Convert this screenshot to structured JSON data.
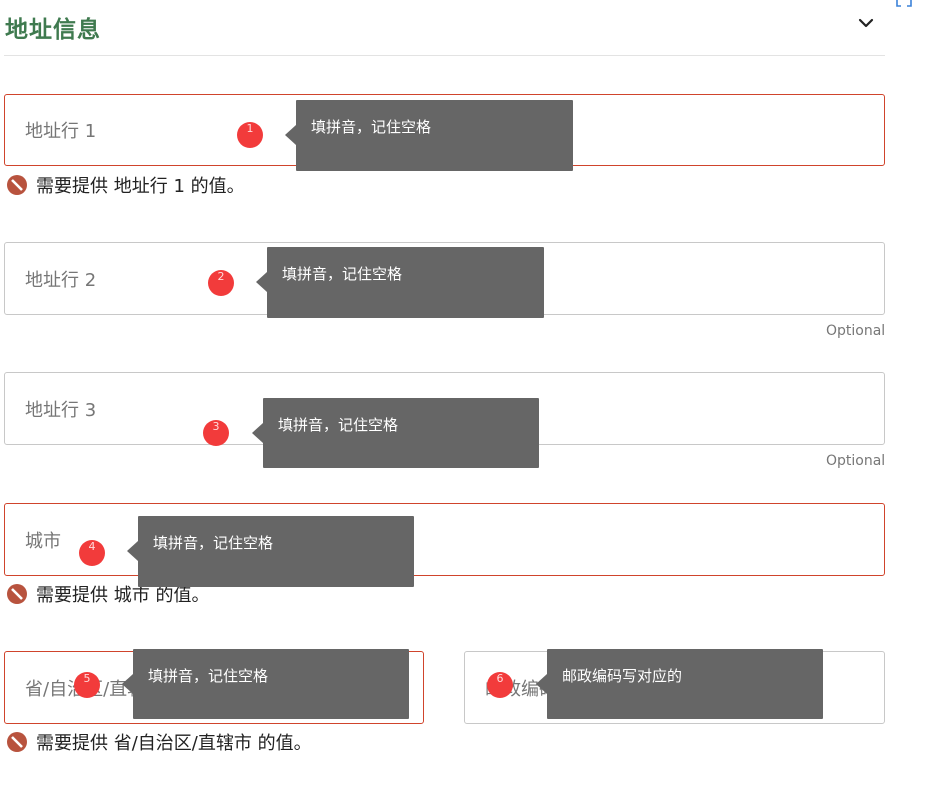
{
  "section": {
    "title": "地址信息"
  },
  "fields": {
    "address1": {
      "placeholder": "地址行 1",
      "error": "需要提供 地址行 1 的值。"
    },
    "address2": {
      "placeholder": "地址行 2",
      "optional": "Optional"
    },
    "address3": {
      "placeholder": "地址行 3",
      "optional": "Optional"
    },
    "city": {
      "placeholder": "城市",
      "error": "需要提供 城市 的值。"
    },
    "state": {
      "placeholder": "省/自治区/直辖市",
      "error": "需要提供 省/自治区/直辖市 的值。"
    },
    "postal": {
      "placeholder": "邮政编码"
    }
  },
  "tips": {
    "pinyin": "填拼音，记住空格",
    "postal": "邮政编码写对应的"
  },
  "markers": [
    "1",
    "2",
    "3",
    "4",
    "5",
    "6"
  ],
  "colors": {
    "title": "#3f7a4f",
    "error_border": "#d0442c",
    "error_icon": "#b8533e",
    "marker": "#f23b3b",
    "tooltip": "#666666"
  },
  "icons": {
    "collapse": "chevron-down-icon",
    "error": "no-entry-icon",
    "corner": "expand-corner-icon"
  }
}
